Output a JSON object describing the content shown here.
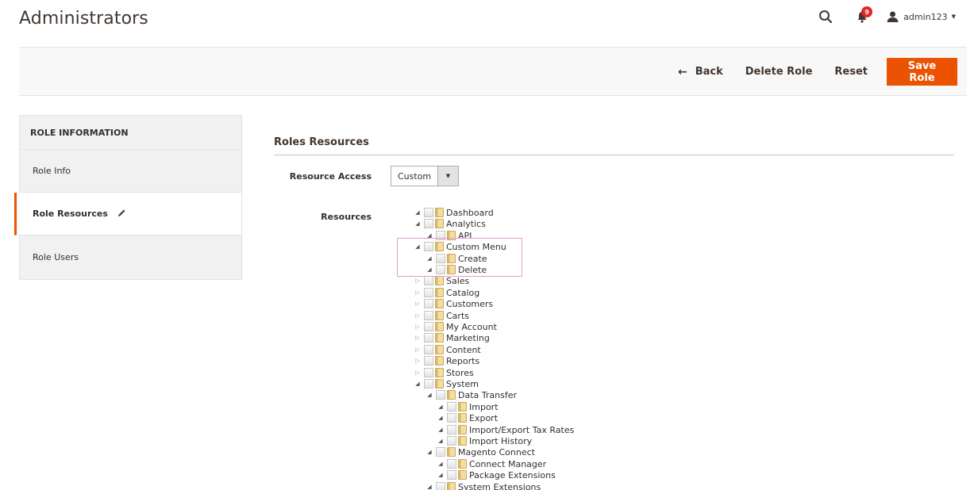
{
  "page": {
    "title": "Administrators"
  },
  "header": {
    "notifications_count": "9",
    "user_name": "admin123",
    "icons": {
      "search": "search-icon",
      "notifications": "bell-icon",
      "user": "user-icon",
      "caret": "caret-down-icon"
    }
  },
  "toolbar": {
    "back_label": "Back",
    "delete_label": "Delete Role",
    "reset_label": "Reset",
    "save_label": "Save Role",
    "save_color": "#eb5202"
  },
  "sidebar": {
    "title": "ROLE INFORMATION",
    "items": [
      {
        "label": "Role Info",
        "active": false
      },
      {
        "label": "Role Resources",
        "active": true
      },
      {
        "label": "Role Users",
        "active": false
      }
    ]
  },
  "main": {
    "section_title": "Roles Resources",
    "resource_access_label": "Resource Access",
    "resource_access_value": "Custom",
    "resources_label": "Resources",
    "tree": [
      {
        "label": "Dashboard",
        "depth": 0,
        "expanded": true
      },
      {
        "label": "Analytics",
        "depth": 0,
        "expanded": true
      },
      {
        "label": "API",
        "depth": 1,
        "expanded": true
      },
      {
        "label": "Custom Menu",
        "depth": 0,
        "expanded": true
      },
      {
        "label": "Create",
        "depth": 1,
        "expanded": true
      },
      {
        "label": "Delete",
        "depth": 1,
        "expanded": true
      },
      {
        "label": "Sales",
        "depth": 0,
        "expanded": false
      },
      {
        "label": "Catalog",
        "depth": 0,
        "expanded": false
      },
      {
        "label": "Customers",
        "depth": 0,
        "expanded": false
      },
      {
        "label": "Carts",
        "depth": 0,
        "expanded": false
      },
      {
        "label": "My Account",
        "depth": 0,
        "expanded": false
      },
      {
        "label": "Marketing",
        "depth": 0,
        "expanded": false
      },
      {
        "label": "Content",
        "depth": 0,
        "expanded": false
      },
      {
        "label": "Reports",
        "depth": 0,
        "expanded": false
      },
      {
        "label": "Stores",
        "depth": 0,
        "expanded": false
      },
      {
        "label": "System",
        "depth": 0,
        "expanded": true
      },
      {
        "label": "Data Transfer",
        "depth": 1,
        "expanded": true
      },
      {
        "label": "Import",
        "depth": 2,
        "expanded": true
      },
      {
        "label": "Export",
        "depth": 2,
        "expanded": true
      },
      {
        "label": "Import/Export Tax Rates",
        "depth": 2,
        "expanded": true
      },
      {
        "label": "Import History",
        "depth": 2,
        "expanded": true
      },
      {
        "label": "Magento Connect",
        "depth": 1,
        "expanded": true
      },
      {
        "label": "Connect Manager",
        "depth": 2,
        "expanded": true
      },
      {
        "label": "Package Extensions",
        "depth": 2,
        "expanded": true
      },
      {
        "label": "System Extensions",
        "depth": 1,
        "expanded": true
      }
    ]
  }
}
